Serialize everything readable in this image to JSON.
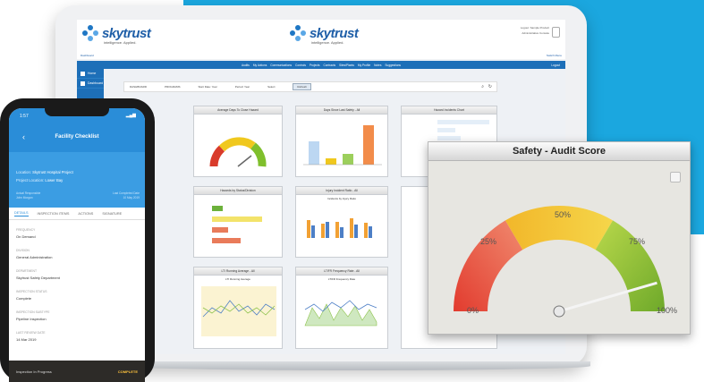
{
  "brand": {
    "name": "skytrust",
    "tagline": "intelligence. Applied."
  },
  "header": {
    "user_line1": "Logout: Sample Product",
    "user_line2": "Administrative Console",
    "left_link": "Dashboard",
    "right_link": "Switch Menu"
  },
  "nav": [
    "Audits",
    "My Actions",
    "Communications",
    "Controls",
    "Projects",
    "Contracts",
    "Sites/Plants",
    "My Profile",
    "Notes",
    "Suggestions"
  ],
  "nav_right": "Logout",
  "sidebar": [
    "Home",
    "Dashboard"
  ],
  "filter": {
    "a": "DASHBOARD",
    "b": "PROGRAMS",
    "c": "Start Date: Year",
    "d": "Period: Year",
    "e": "Select",
    "go": "Refresh"
  },
  "small_label": "Date",
  "panels": {
    "p1": "Average Days To Close Hazard",
    "p2": "Days Since Last Safety - All",
    "p3": "Hazard Incidents Chart",
    "p4": "Hazards by Status/Division",
    "p5": "Injury Incident Ratio - All",
    "p6": "LTI Running Average - All",
    "p7": "LTIFR Frequency Rate - All",
    "p5_inner": "Incidents by Injury Ratio",
    "p6_inner": "LTI Running Average",
    "p7_inner": "LTIFR Frequency Rate"
  },
  "gauge": {
    "title": "Safety - Audit Score",
    "labels": [
      "0%",
      "25%",
      "50%",
      "75%",
      "100%"
    ],
    "value_pct": 91
  },
  "phone": {
    "time": "1:57",
    "title": "Facility Checklist",
    "location_label": "Location:",
    "location_value": "Skytrust Hospital Project",
    "project_label": "Project Location:",
    "project_value": "Lower Bay",
    "left_small1": "Actual Responsible",
    "left_small2": "John Morgan",
    "right_small1": "Last Completed Date",
    "right_small2": "10 May 2019",
    "tabs": [
      "DETAILS",
      "INSPECTION ITEMS",
      "ACTIONS",
      "SIGNATURE"
    ],
    "fields": [
      {
        "label": "FREQUENCY",
        "value": "On Demand"
      },
      {
        "label": "DIVISION",
        "value": "General Administration"
      },
      {
        "label": "DEPARTMENT",
        "value": "Skytrust Safety Department"
      },
      {
        "label": "INSPECTION STATUS",
        "value": "Complete"
      },
      {
        "label": "INSPECTION SUBTYPE",
        "value": "Pipeline Inspection"
      },
      {
        "label": "LAST REVIEW DATE",
        "value": "14 Mar 2019"
      }
    ],
    "footer_left": "Inspection In Progress",
    "footer_right": "COMPLETE"
  }
}
